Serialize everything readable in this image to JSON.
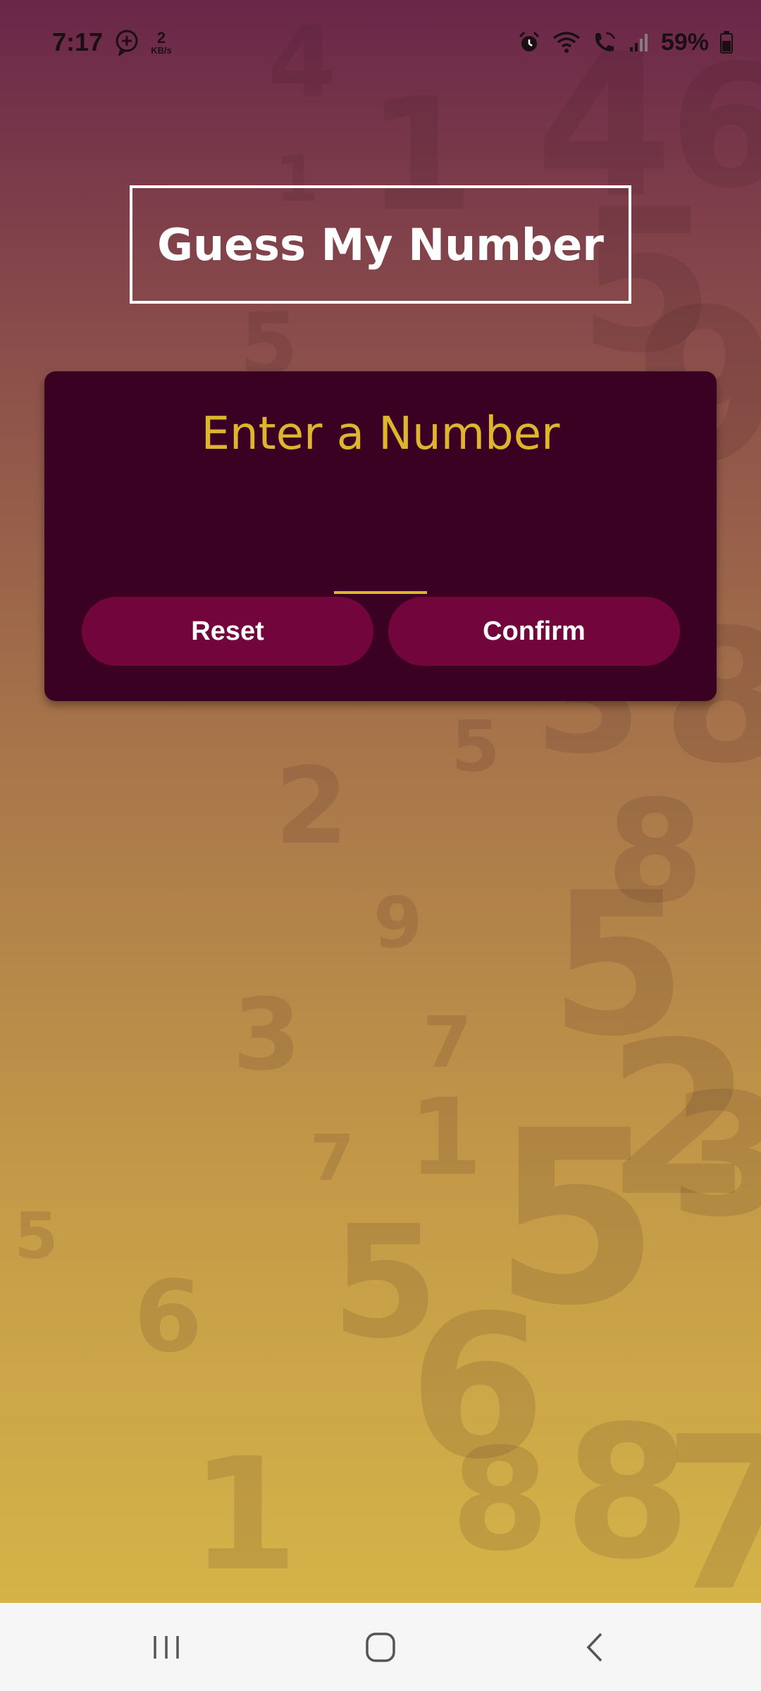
{
  "status_bar": {
    "time": "7:17",
    "net_speed_value": "2",
    "net_speed_unit": "KB/s",
    "battery_percent": "59%"
  },
  "title": "Guess My Number",
  "card": {
    "heading": "Enter a Number",
    "input_value": "",
    "reset_label": "Reset",
    "confirm_label": "Confirm"
  },
  "colors": {
    "card_bg": "#3b0122",
    "accent": "#ddb52f",
    "button_bg": "#72063c",
    "gradient_top": "#6a2749",
    "gradient_bottom": "#d9b948"
  },
  "nav_bar": {
    "icons": [
      "recent-apps-icon",
      "home-icon",
      "back-icon"
    ]
  }
}
